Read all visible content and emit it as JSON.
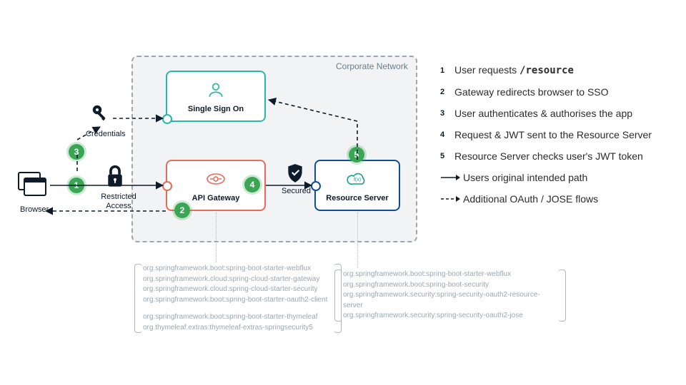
{
  "corpnet_label": "Corporate Network",
  "nodes": {
    "sso": "Single Sign On",
    "gateway": "API Gateway",
    "resource": "Resource Server",
    "browser": "Browser",
    "credentials": "Credentials",
    "restricted": "Restricted Access",
    "secured": "Secured"
  },
  "steps": [
    "1",
    "2",
    "3",
    "4",
    "5"
  ],
  "legend": [
    {
      "n": "1",
      "text": "User requests ",
      "code": "/resource"
    },
    {
      "n": "2",
      "text": "Gateway redirects browser to SSO"
    },
    {
      "n": "3",
      "text": "User authenticates & authorises the app"
    },
    {
      "n": "4",
      "text": "Request & JWT sent to the Resource Server"
    },
    {
      "n": "5",
      "text": "Resource Server checks user's JWT token"
    }
  ],
  "legend_lines": {
    "solid": "Users original intended path",
    "dashed": "Additional OAuth / JOSE flows"
  },
  "deps_gateway": [
    "org.springframework.boot:spring-boot-starter-webflux",
    "org.springframework.cloud:spring-cloud-starter-gateway",
    "org.springframework.cloud:spring-cloud-starter-security",
    "org.springframework.boot:spring-boot-starter-oauth2-client",
    "",
    "org.springframework.boot:spring-boot-starter-thymeleaf",
    "org.thymeleaf.extras:thymeleaf-extras-springsecurity5"
  ],
  "deps_resource": [
    "org.springframework.boot:spring-boot-starter-webflux",
    "org.springframework.boot:spring-boot-security",
    "org.springframework.security:spring-security-oauth2-resource-server",
    "org.springframework.security:spring-security-oauth2-jose"
  ]
}
